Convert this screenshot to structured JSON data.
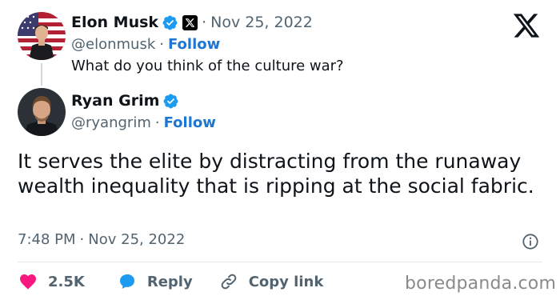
{
  "quoted": {
    "name": "Elon Musk",
    "date": "Nov 25, 2022",
    "dot": "·",
    "handle": "@elonmusk",
    "follow": "Follow",
    "text": "What do you think of the culture war?"
  },
  "reply": {
    "name": "Ryan Grim",
    "handle": "@ryangrim",
    "dot": "·",
    "follow": "Follow",
    "text": "It serves the elite by distracting from the runaway wealth inequality that is ripping at the social fabric.",
    "time": "7:48 PM",
    "date": "Nov 25, 2022"
  },
  "actions": {
    "likes": "2.5K",
    "reply": "Reply",
    "copy_link": "Copy link"
  },
  "watermark": "boredpanda.com",
  "colors": {
    "verified": "#1d9bf0",
    "like": "#f91880",
    "reply": "#1d9bf0",
    "follow": "#1d76d2"
  },
  "icons": [
    "verified-badge-icon",
    "x-affiliate-badge-icon",
    "x-logo-icon",
    "info-icon",
    "heart-icon",
    "reply-bubble-icon",
    "link-icon"
  ]
}
